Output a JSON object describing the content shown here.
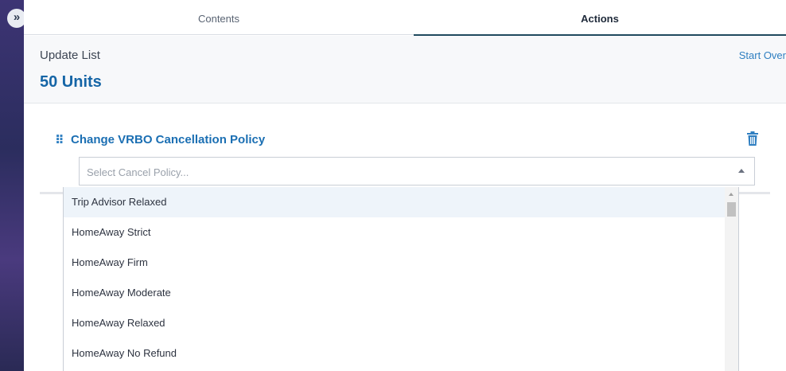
{
  "sidebar_toggle": {
    "icon": "double-chevron-right-icon",
    "glyph": "»"
  },
  "tabs": [
    {
      "label": "Contents",
      "active": false
    },
    {
      "label": "Actions",
      "active": true
    }
  ],
  "header": {
    "title": "Update List",
    "count": "50 Units",
    "start_over": "Start Over"
  },
  "action": {
    "title": "Change VRBO Cancellation Policy",
    "handle_glyph": "⠿",
    "delete_icon": "trash-icon",
    "select": {
      "placeholder": "Select Cancel Policy...",
      "value": ""
    },
    "options": [
      {
        "label": "Trip Advisor Relaxed",
        "highlighted": true
      },
      {
        "label": "HomeAway Strict",
        "highlighted": false
      },
      {
        "label": "HomeAway Firm",
        "highlighted": false
      },
      {
        "label": "HomeAway Moderate",
        "highlighted": false
      },
      {
        "label": "HomeAway Relaxed",
        "highlighted": false
      },
      {
        "label": "HomeAway No Refund",
        "highlighted": false
      }
    ]
  },
  "colors": {
    "accent": "#1b6fb3",
    "link": "#2f7fc1",
    "tab_underline": "#1f4a5e",
    "highlight": "#eef4fa"
  }
}
